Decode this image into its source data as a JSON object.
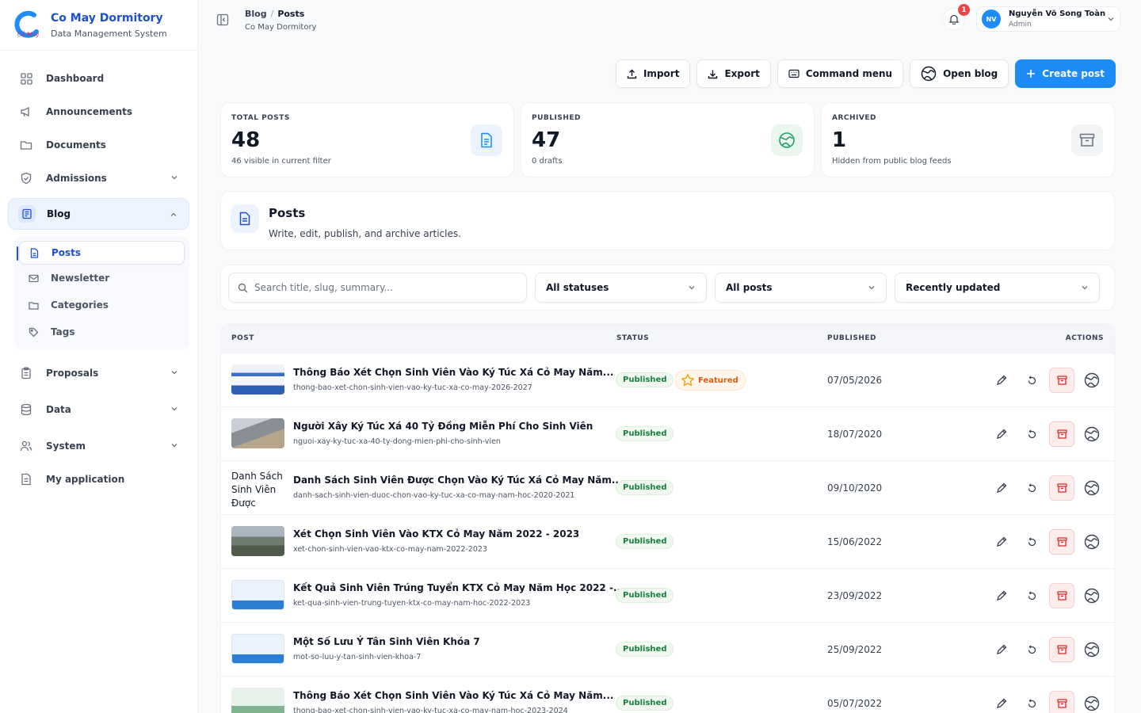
{
  "brand": {
    "title": "Co May Dormitory",
    "subtitle": "Data Management System"
  },
  "sidebar": {
    "items": [
      {
        "label": "Dashboard"
      },
      {
        "label": "Announcements"
      },
      {
        "label": "Documents"
      },
      {
        "label": "Admissions"
      },
      {
        "label": "Blog"
      },
      {
        "label": "Proposals"
      },
      {
        "label": "Data"
      },
      {
        "label": "System"
      },
      {
        "label": "My application"
      }
    ],
    "blog_sub": [
      {
        "label": "Posts"
      },
      {
        "label": "Newsletter"
      },
      {
        "label": "Categories"
      },
      {
        "label": "Tags"
      }
    ]
  },
  "header": {
    "breadcrumb_parent": "Blog",
    "breadcrumb_sep": "/",
    "breadcrumb_current": "Posts",
    "subtitle": "Co May Dormitory",
    "notifications": "1",
    "user_initials": "NV",
    "user_name": "Nguyễn Võ Song Toàn",
    "user_role": "Admin"
  },
  "toolbar": {
    "import": "Import",
    "export": "Export",
    "command": "Command menu",
    "open_blog": "Open blog",
    "create": "Create post"
  },
  "stats": [
    {
      "label": "TOTAL POSTS",
      "value": "48",
      "sub": "46 visible in current filter",
      "accent": "#1d8cf8"
    },
    {
      "label": "PUBLISHED",
      "value": "47",
      "sub": "0 drafts",
      "accent": "#22a06b"
    },
    {
      "label": "ARCHIVED",
      "value": "1",
      "sub": "Hidden from public blog feeds",
      "accent": "#6b7280"
    }
  ],
  "posts_header": {
    "title": "Posts",
    "description": "Write, edit, publish, and archive articles."
  },
  "filters": {
    "search_placeholder": "Search title, slug, summary...",
    "status": "All statuses",
    "scope": "All posts",
    "sort": "Recently updated"
  },
  "table": {
    "columns": {
      "post": "POST",
      "status": "STATUS",
      "published": "PUBLISHED",
      "actions": "ACTIONS"
    },
    "rows": [
      {
        "title": "Thông Báo Xét Chọn Sinh Viên Vào Ký Túc Xá Cỏ May Năm...",
        "slug": "thong-bao-xet-chon-sinh-vien-vao-ky-tuc-xa-co-may-2026-2027",
        "status": "Published",
        "featured": "Featured",
        "date": "07/05/2026",
        "thumb": "poster"
      },
      {
        "title": "Người Xây Ký Túc Xá 40 Tỷ Đồng Miễn Phí Cho Sinh Viên",
        "slug": "nguoi-xay-ky-tuc-xa-40-ty-dong-mien-phi-cho-sinh-vien",
        "status": "Published",
        "featured": "",
        "date": "18/07/2020",
        "thumb": "building"
      },
      {
        "title": "Danh Sách Sinh Viên Được Chọn Vào Ký Túc Xá Cỏ May Năm...",
        "slug": "danh-sach-sinh-vien-duoc-chon-vao-ky-tuc-xa-co-may-nam-hoc-2020-2021",
        "status": "Published",
        "featured": "",
        "date": "09/10/2020",
        "thumb": "broken",
        "thumb_alt": "Danh Sách Sinh Viên Được"
      },
      {
        "title": "Xét Chọn Sinh Viên Vào KTX Cỏ May Năm 2022 - 2023",
        "slug": "xet-chon-sinh-vien-vao-ktx-co-may-nam-2022-2023",
        "status": "Published",
        "featured": "",
        "date": "15/06/2022",
        "thumb": "campus"
      },
      {
        "title": "Kết Quả Sinh Viên Trúng Tuyển KTX Cỏ May Năm Học 2022 -...",
        "slug": "ket-qua-sinh-vien-trung-tuyen-ktx-co-may-nam-hoc-2022-2023",
        "status": "Published",
        "featured": "",
        "date": "23/09/2022",
        "thumb": "card"
      },
      {
        "title": "Một Số Lưu Ý Tân Sinh Viên Khóa 7",
        "slug": "mot-so-luu-y-tan-sinh-vien-khoa-7",
        "status": "Published",
        "featured": "",
        "date": "25/09/2022",
        "thumb": "card"
      },
      {
        "title": "Thông Báo Xét Chọn Sinh Viên Vào Ký Túc Xá Cỏ May Năm...",
        "slug": "thong-bao-xet-chon-sinh-vien-vao-ky-tuc-xa-co-may-nam-hoc-2023-2024",
        "status": "Published",
        "featured": "",
        "date": "05/07/2022",
        "thumb": "green"
      }
    ]
  }
}
